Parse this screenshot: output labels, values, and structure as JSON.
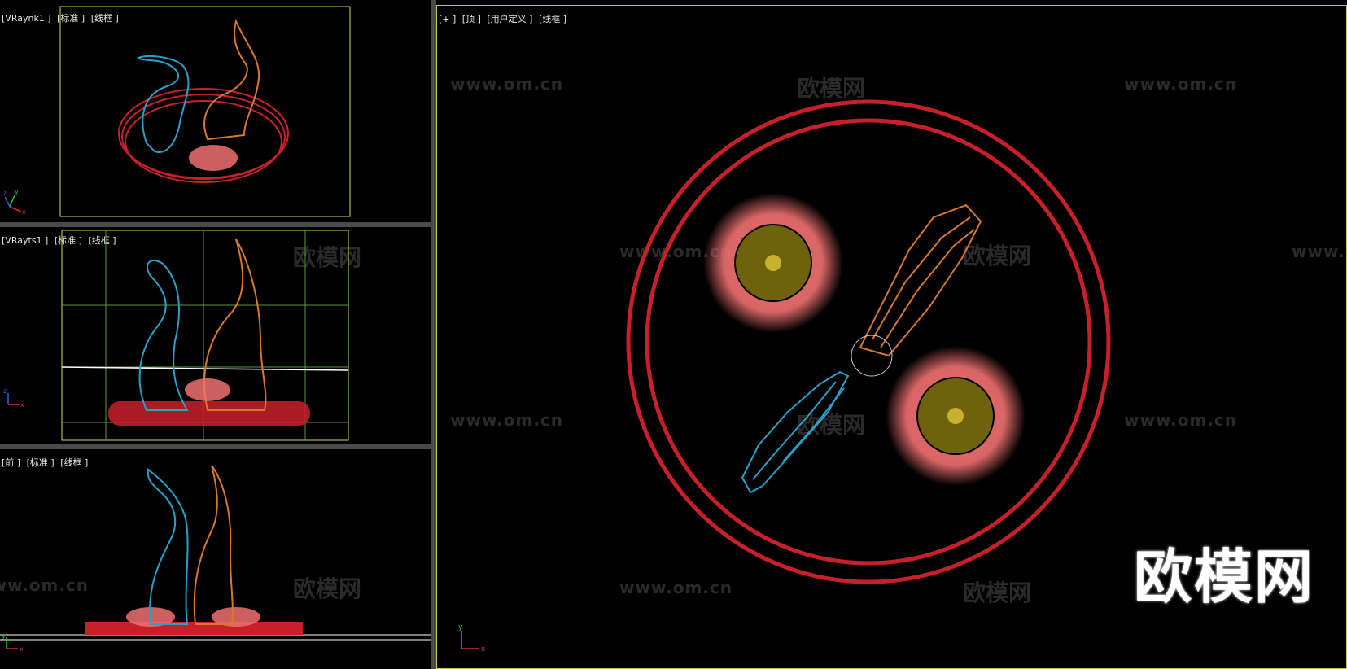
{
  "viewports": {
    "persp1": {
      "labels": [
        "[VRaynk1 ]",
        "[标准 ]",
        "[线框 ]"
      ]
    },
    "persp2": {
      "labels": [
        "[VRayts1 ]",
        "[标准 ]",
        "[线框 ]"
      ]
    },
    "front": {
      "labels": [
        "[前 ]",
        "[标准 ]",
        "[线框 ]"
      ]
    },
    "top": {
      "labels": [
        "[+ ]",
        "[顶 ]",
        "[用户定义 ]",
        "[线框 ]"
      ]
    }
  },
  "watermark": {
    "url": "www.om.cn",
    "cn": "欧模网"
  },
  "brand_logo": "欧模网",
  "axis_labels": {
    "x": "x",
    "y": "y",
    "z": "z"
  },
  "colors": {
    "background": "#000000",
    "active_border": "#c8c84a",
    "red_ring": "#c8202a",
    "cyan_mesh": "#2aa0c8",
    "orange_mesh": "#d8782a",
    "pink_scatter": "#f07070",
    "olive_core": "#8a7a10",
    "camera_frame": "#d8d860"
  }
}
